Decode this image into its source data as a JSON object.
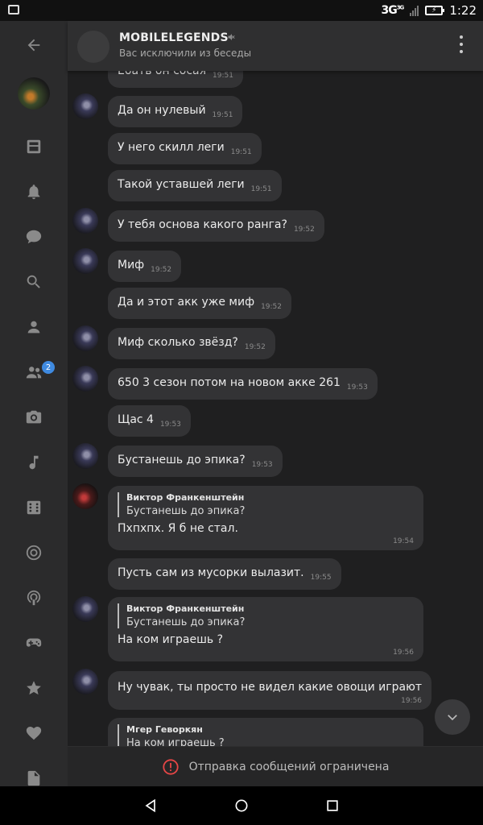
{
  "status_bar": {
    "network": "3G",
    "network_sup": "3G",
    "time": "1:22"
  },
  "sidebar": {
    "items": [
      {
        "name": "back",
        "icon": "arrow-left-icon"
      },
      {
        "name": "profile",
        "icon": "avatar"
      },
      {
        "name": "news",
        "icon": "newspaper-icon"
      },
      {
        "name": "notifications",
        "icon": "bell-icon"
      },
      {
        "name": "messages",
        "icon": "chat-icon"
      },
      {
        "name": "search",
        "icon": "search-icon"
      },
      {
        "name": "friends",
        "icon": "person-icon"
      },
      {
        "name": "groups",
        "icon": "group-icon",
        "badge": "2"
      },
      {
        "name": "photos",
        "icon": "camera-icon"
      },
      {
        "name": "music",
        "icon": "music-note-icon"
      },
      {
        "name": "games",
        "icon": "dice-icon"
      },
      {
        "name": "clips",
        "icon": "target-icon"
      },
      {
        "name": "podcasts",
        "icon": "podcast-icon"
      },
      {
        "name": "gamepad",
        "icon": "gamepad-icon"
      },
      {
        "name": "favorites",
        "icon": "star-icon"
      },
      {
        "name": "likes",
        "icon": "heart-icon"
      },
      {
        "name": "documents",
        "icon": "document-icon"
      }
    ]
  },
  "header": {
    "title": "MOBILELEGENDS",
    "subtitle": "Вас исключили из беседы",
    "mute_icon": "muted-speaker-icon",
    "menu_icon": "more-vertical-icon"
  },
  "messages": [
    {
      "text": "Ебать он сосая",
      "time": "19:51",
      "avatar": false
    },
    {
      "text": "Да он нулевый",
      "time": "19:51",
      "avatar": true
    },
    {
      "text": "У него скилл леги",
      "time": "19:51",
      "avatar": false
    },
    {
      "text": "Такой уставшей леги",
      "time": "19:51",
      "avatar": false
    },
    {
      "text": "У тебя основа какого ранга?",
      "time": "19:52",
      "avatar": true
    },
    {
      "text": "Миф",
      "time": "19:52",
      "avatar": true
    },
    {
      "text": "Да и этот акк уже миф",
      "time": "19:52",
      "avatar": false
    },
    {
      "text": "Миф сколько звёзд?",
      "time": "19:52",
      "avatar": true
    },
    {
      "text": "650 3 сезон потом на новом акке  261",
      "time": "19:53",
      "avatar": true
    },
    {
      "text": "Щас 4",
      "time": "19:53",
      "avatar": false
    },
    {
      "text": "Бустанешь до эпика?",
      "time": "19:53",
      "avatar": true
    },
    {
      "reply_name": "Виктор Франкенштейн",
      "reply_text": "Бустанешь до эпика?",
      "text": "Пхпхпх. Я б не стал.",
      "time": "19:54",
      "avatar": true
    },
    {
      "text": "Пусть сам из мусорки вылазит.",
      "time": "19:55",
      "avatar": false
    },
    {
      "reply_name": "Виктор Франкенштейн",
      "reply_text": "Бустанешь до эпика?",
      "text": "На ком играешь ?",
      "time": "19:56",
      "avatar": true
    },
    {
      "text": "Ну чувак, ты просто не видел какие овощи играют",
      "time": "19:56",
      "avatar": true
    },
    {
      "reply_name": "Мгер Геворкян",
      "reply_text": "На ком играешь ?",
      "text": "",
      "time": "",
      "avatar": false
    }
  ],
  "scroll_down_icon": "chevron-down-icon",
  "restriction": {
    "icon": "alert-circle-icon",
    "text": "Отправка сообщений ограничена"
  },
  "colors": {
    "background": "#1f1f20",
    "bubble": "#333335",
    "badge": "#3f8ae0",
    "alert": "#e64646"
  }
}
